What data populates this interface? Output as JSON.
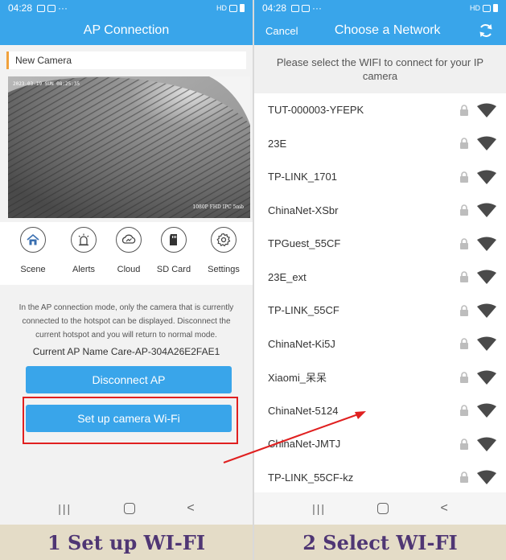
{
  "left": {
    "status": {
      "time": "04:28",
      "dots": "···",
      "hd": "HD"
    },
    "header_title": "AP Connection",
    "camera_name": "New Camera",
    "camera_timestamp": "2023-03-19 SUN 08:25:35",
    "camera_watermark": "1080P FHD IPC 5mb",
    "toolbar": [
      {
        "label": "Scene",
        "icon": "scene-icon"
      },
      {
        "label": "Alerts",
        "icon": "alarm-icon"
      },
      {
        "label": "Cloud",
        "icon": "cloud-icon"
      },
      {
        "label": "SD Card",
        "icon": "sd-card-icon"
      },
      {
        "label": "Settings",
        "icon": "gear-icon"
      }
    ],
    "info_text": "In the AP connection mode, only the camera that is currently connected to the hotspot can be displayed. Disconnect the current hotspot and you will return to normal mode.",
    "ap_name": "Current AP Name Care-AP-304A26E2FAE1",
    "disconnect_label": "Disconnect AP",
    "setup_label": "Set up camera Wi-Fi",
    "nav": {
      "recent": "|||",
      "home": "",
      "back": "<"
    },
    "caption": "1 Set up WI-FI"
  },
  "right": {
    "status": {
      "time": "04:28",
      "dots": "···",
      "hd": "HD"
    },
    "cancel_label": "Cancel",
    "header_title": "Choose a Network",
    "prompt": "Please select the WIFI to connect for your IP camera",
    "networks": [
      "TUT-000003-YFEPK",
      "23E",
      "TP-LINK_1701",
      "ChinaNet-XSbr",
      "TPGuest_55CF",
      "23E_ext",
      "TP-LINK_55CF",
      "ChinaNet-Ki5J",
      "Xiaomi_呆呆",
      "ChinaNet-5124",
      "ChinaNet-JMTJ",
      "TP-LINK_55CF-kz"
    ],
    "nav": {
      "recent": "|||",
      "home": "",
      "back": "<"
    },
    "caption": "2 Select WI-FI"
  },
  "colors": {
    "accent": "#39a5ea",
    "highlight": "#e02020",
    "caption_bg": "#e4dcc7",
    "caption_text": "#4f3674"
  }
}
